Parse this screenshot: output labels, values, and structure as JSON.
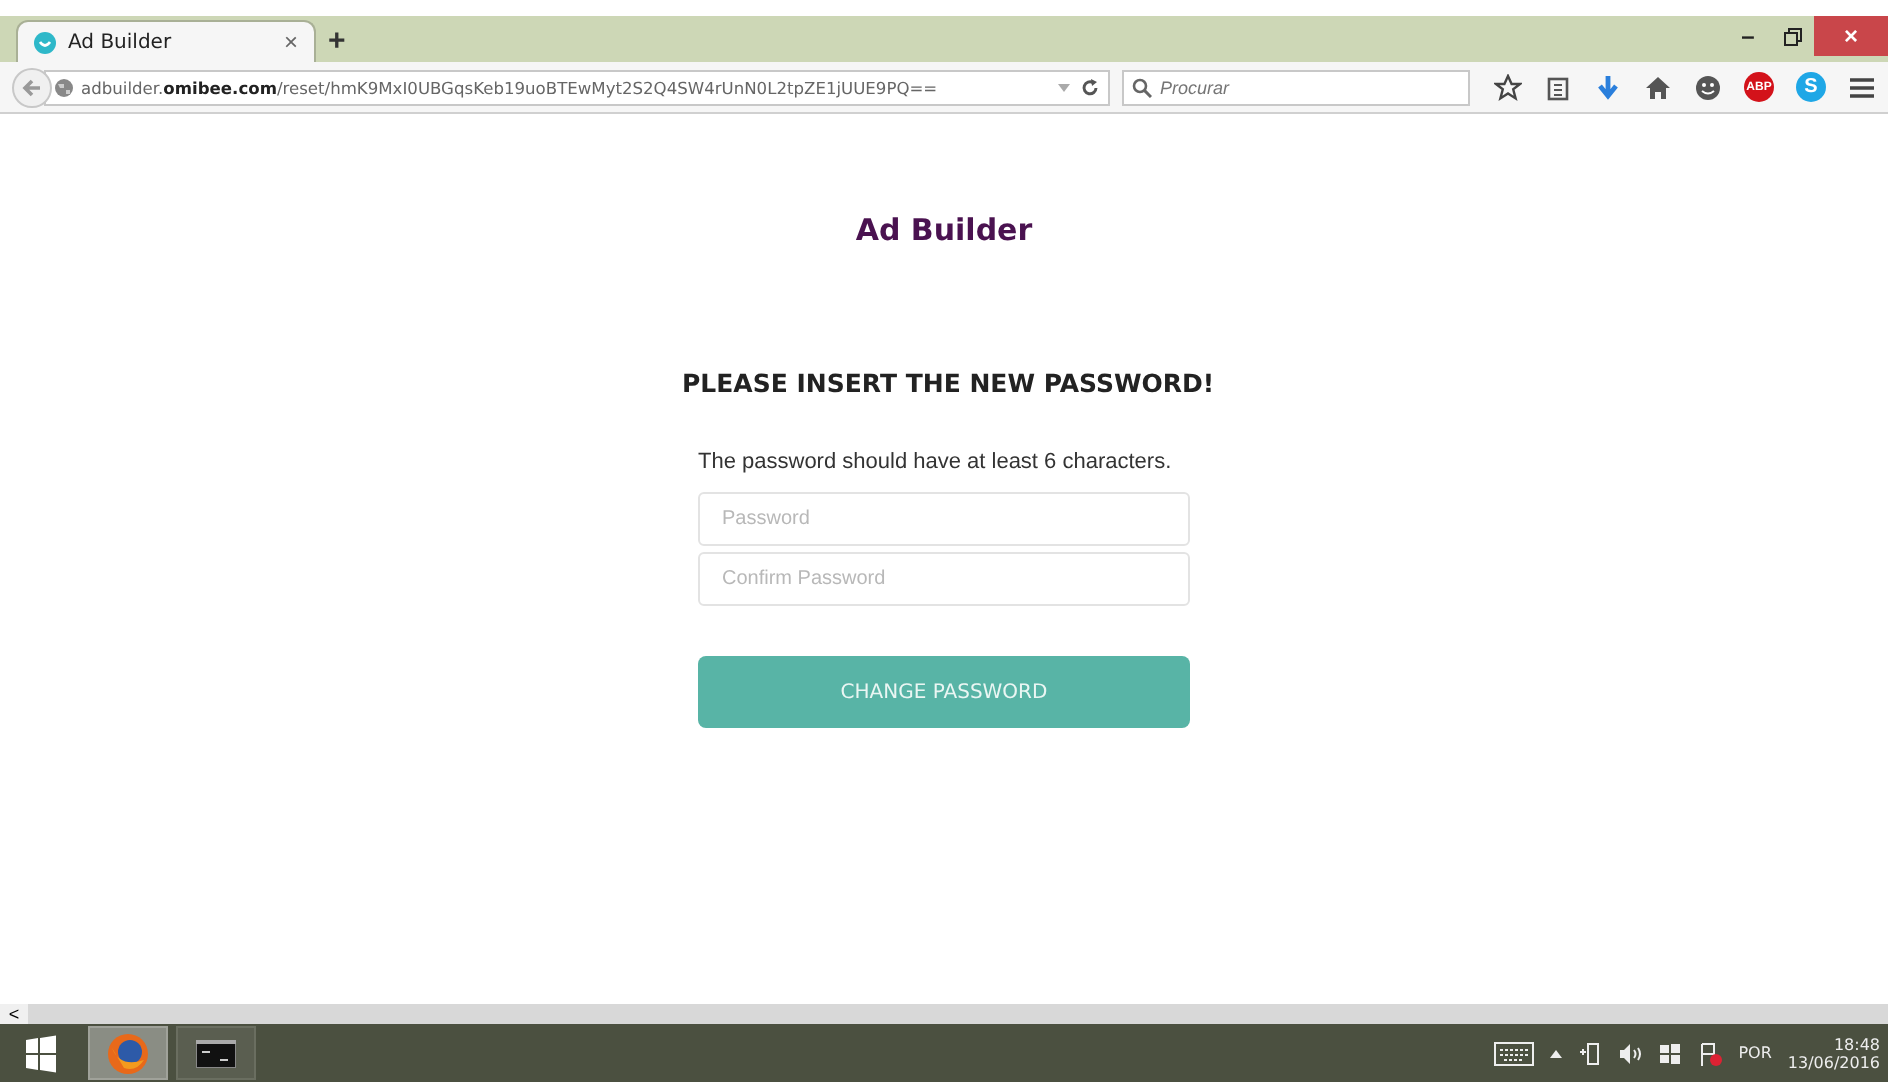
{
  "tabs": [
    {
      "title": "Ad Builder",
      "close": "×",
      "selected": true
    }
  ],
  "new_tab": "+",
  "window_controls": {
    "minimize": "–",
    "close": "×"
  },
  "address": {
    "url": "adbuilder.**omibee.com**/reset/hmK9MxI0UBGqsKeb19uoBTEwMyt2S2Q4SW4rUnN0L2tpZE1jUUE9PQ=="
  },
  "search": {
    "placeholder": "Procurar"
  },
  "toolbar": {
    "adblock_badge": "ABP",
    "skype_badge": "S"
  },
  "page": {
    "brand": "Ad Builder",
    "heading": "PLEASE INSERT THE NEW PASSWORD!",
    "hint": "The password should have at least 6 characters.",
    "fields": [
      {
        "placeholder": "Password"
      },
      {
        "placeholder": "Confirm Password"
      }
    ],
    "button": "CHANGE PASSWORD"
  },
  "scrollbar": {
    "arrow": "<"
  },
  "taskbar": {
    "apps": [
      {
        "kind": "firefox",
        "selected": true
      },
      {
        "kind": "terminal",
        "selected": false
      }
    ],
    "language": "POR",
    "time": "18:48",
    "date": "13/06/2016"
  }
}
